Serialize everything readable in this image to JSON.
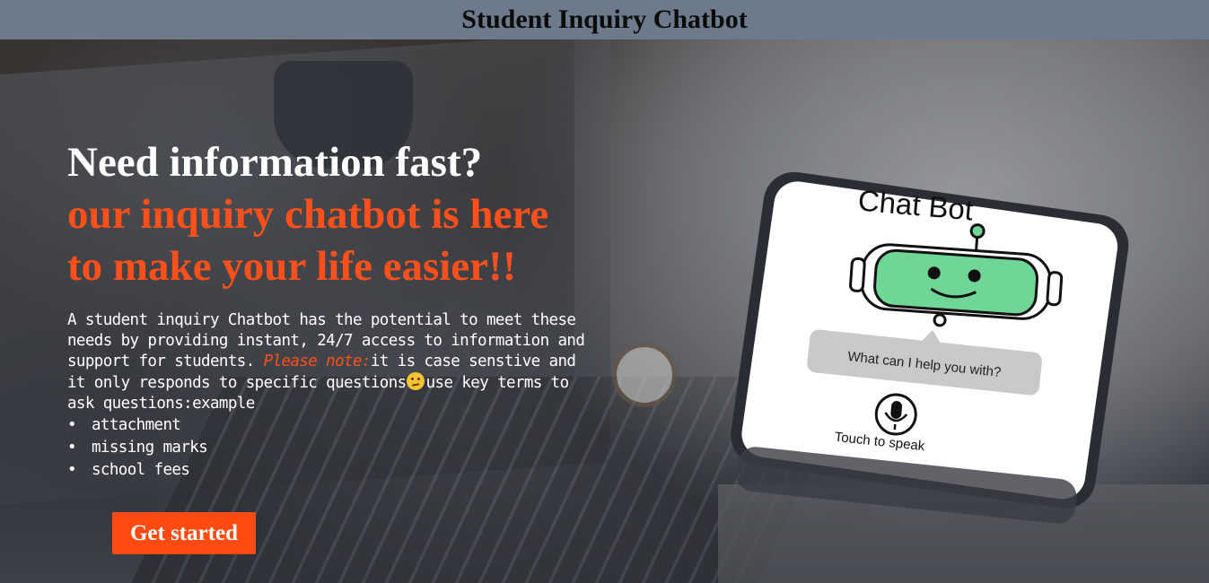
{
  "header": {
    "title": "Student Inquiry Chatbot"
  },
  "hero": {
    "headline": "Need information fast?",
    "accent_line_1": "our inquiry chatbot is here",
    "accent_line_2": "to make your life easier!!",
    "description_part_1": "A student inquiry Chatbot has the potential to meet these needs by providing instant, 24/7 access to information and support for students. ",
    "note_label": "Please note:",
    "description_part_2": "it is case senstive and it only responds to specific questions",
    "description_part_3": "use key terms to ask questions:example",
    "emoji_icon": "confused-face-icon",
    "terms": [
      {
        "bullet": "•",
        "label": "attachment"
      },
      {
        "bullet": "•",
        "label": "missing marks"
      },
      {
        "bullet": "•",
        "label": "school fees"
      }
    ],
    "cta_label": "Get started"
  },
  "phone": {
    "title": "Chat Bot",
    "bubble_text": "What can I help you with?",
    "speak_label": "Touch to speak",
    "robot_icon": "robot-face-icon",
    "mic_icon": "microphone-icon"
  },
  "colors": {
    "header_bg": "#6c7a8c",
    "accent": "#ff4f1a",
    "cta_bg": "#ff4b12",
    "robot_face": "#6fd698"
  }
}
